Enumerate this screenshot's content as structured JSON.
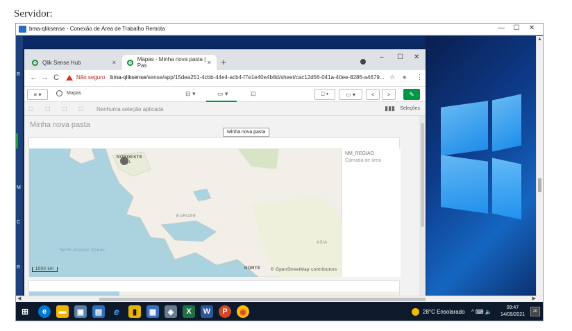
{
  "caption": "Servidor:",
  "rdp": {
    "title": "bma-qliksense - Conexão de Área de Trabalho Remota",
    "minimize": "—",
    "maximize": "☐",
    "close": "✕"
  },
  "browser": {
    "tabs": [
      {
        "label": "Qlik Sense Hub",
        "close": "×"
      },
      {
        "label": "Mapas - Minha nova pasta | Pas",
        "close": "×"
      }
    ],
    "new_tab": "+",
    "minimize": "–",
    "maximize": "☐",
    "close": "✕",
    "back": "←",
    "forward": "→",
    "reload": "C",
    "security_warning": "Não seguro",
    "url_host": "bma-qliksense",
    "url_path": "/sense/app/15dea251-4cbb-44e4-acb4-f7e1e40e4b8d/sheet/cac12d56-041a-40ee-8286-a4679...",
    "star": "☆",
    "account": "●",
    "menu": "⋮"
  },
  "qlik": {
    "menu_label": "≡ ▾",
    "app_name": "Mapas",
    "data_icon": "⊟ ▾",
    "analysis_icon": "▭ ▾",
    "story_icon": "⊡",
    "bookmark": "⎕ ▾",
    "sheets": "▭ ▾",
    "prev": "<",
    "next": ">",
    "edit": "✎",
    "no_selection": "Nenhuma seleção aplicada",
    "selections": "Seleções",
    "sheet_title": "Minha nova pasta",
    "tooltip": "Minha nova pasta",
    "legend_field": "NM_REGIAO",
    "legend_layer": "Camada de área",
    "map_labels": {
      "region": "NORDESTE",
      "region_sub": "SUL",
      "europe": "EUROPE",
      "ocean": "North Atlantic Ocean",
      "asia": "ASIA",
      "norte": "NORTE",
      "scale": "1000 km",
      "attribution": "© OpenStreetMap contributors"
    }
  },
  "taskbar": {
    "weather": "28°C  Ensolarado",
    "tray_icons": "^  ⌨  🔈",
    "time": "09:47",
    "date": "14/09/2021",
    "notifications": "20"
  },
  "colors": {
    "qlik_green": "#009845",
    "warning_red": "#d93025",
    "map_water": "#aad3df",
    "map_land": "#f2efe9"
  }
}
